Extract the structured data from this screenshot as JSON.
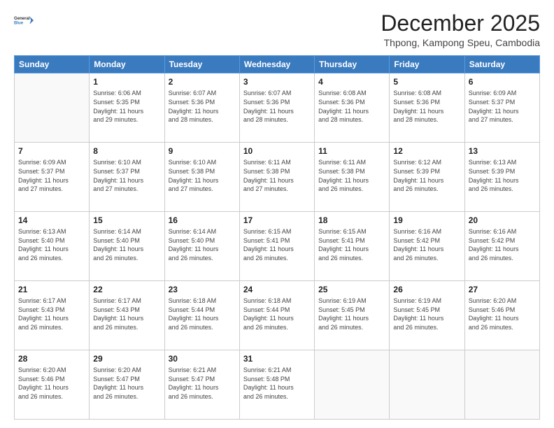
{
  "header": {
    "logo_general": "General",
    "logo_blue": "Blue",
    "month_title": "December 2025",
    "location": "Thpong, Kampong Speu, Cambodia"
  },
  "days_of_week": [
    "Sunday",
    "Monday",
    "Tuesday",
    "Wednesday",
    "Thursday",
    "Friday",
    "Saturday"
  ],
  "weeks": [
    [
      {
        "day": "",
        "info": ""
      },
      {
        "day": "1",
        "info": "Sunrise: 6:06 AM\nSunset: 5:35 PM\nDaylight: 11 hours\nand 29 minutes."
      },
      {
        "day": "2",
        "info": "Sunrise: 6:07 AM\nSunset: 5:36 PM\nDaylight: 11 hours\nand 28 minutes."
      },
      {
        "day": "3",
        "info": "Sunrise: 6:07 AM\nSunset: 5:36 PM\nDaylight: 11 hours\nand 28 minutes."
      },
      {
        "day": "4",
        "info": "Sunrise: 6:08 AM\nSunset: 5:36 PM\nDaylight: 11 hours\nand 28 minutes."
      },
      {
        "day": "5",
        "info": "Sunrise: 6:08 AM\nSunset: 5:36 PM\nDaylight: 11 hours\nand 28 minutes."
      },
      {
        "day": "6",
        "info": "Sunrise: 6:09 AM\nSunset: 5:37 PM\nDaylight: 11 hours\nand 27 minutes."
      }
    ],
    [
      {
        "day": "7",
        "info": "Sunrise: 6:09 AM\nSunset: 5:37 PM\nDaylight: 11 hours\nand 27 minutes."
      },
      {
        "day": "8",
        "info": "Sunrise: 6:10 AM\nSunset: 5:37 PM\nDaylight: 11 hours\nand 27 minutes."
      },
      {
        "day": "9",
        "info": "Sunrise: 6:10 AM\nSunset: 5:38 PM\nDaylight: 11 hours\nand 27 minutes."
      },
      {
        "day": "10",
        "info": "Sunrise: 6:11 AM\nSunset: 5:38 PM\nDaylight: 11 hours\nand 27 minutes."
      },
      {
        "day": "11",
        "info": "Sunrise: 6:11 AM\nSunset: 5:38 PM\nDaylight: 11 hours\nand 26 minutes."
      },
      {
        "day": "12",
        "info": "Sunrise: 6:12 AM\nSunset: 5:39 PM\nDaylight: 11 hours\nand 26 minutes."
      },
      {
        "day": "13",
        "info": "Sunrise: 6:13 AM\nSunset: 5:39 PM\nDaylight: 11 hours\nand 26 minutes."
      }
    ],
    [
      {
        "day": "14",
        "info": "Sunrise: 6:13 AM\nSunset: 5:40 PM\nDaylight: 11 hours\nand 26 minutes."
      },
      {
        "day": "15",
        "info": "Sunrise: 6:14 AM\nSunset: 5:40 PM\nDaylight: 11 hours\nand 26 minutes."
      },
      {
        "day": "16",
        "info": "Sunrise: 6:14 AM\nSunset: 5:40 PM\nDaylight: 11 hours\nand 26 minutes."
      },
      {
        "day": "17",
        "info": "Sunrise: 6:15 AM\nSunset: 5:41 PM\nDaylight: 11 hours\nand 26 minutes."
      },
      {
        "day": "18",
        "info": "Sunrise: 6:15 AM\nSunset: 5:41 PM\nDaylight: 11 hours\nand 26 minutes."
      },
      {
        "day": "19",
        "info": "Sunrise: 6:16 AM\nSunset: 5:42 PM\nDaylight: 11 hours\nand 26 minutes."
      },
      {
        "day": "20",
        "info": "Sunrise: 6:16 AM\nSunset: 5:42 PM\nDaylight: 11 hours\nand 26 minutes."
      }
    ],
    [
      {
        "day": "21",
        "info": "Sunrise: 6:17 AM\nSunset: 5:43 PM\nDaylight: 11 hours\nand 26 minutes."
      },
      {
        "day": "22",
        "info": "Sunrise: 6:17 AM\nSunset: 5:43 PM\nDaylight: 11 hours\nand 26 minutes."
      },
      {
        "day": "23",
        "info": "Sunrise: 6:18 AM\nSunset: 5:44 PM\nDaylight: 11 hours\nand 26 minutes."
      },
      {
        "day": "24",
        "info": "Sunrise: 6:18 AM\nSunset: 5:44 PM\nDaylight: 11 hours\nand 26 minutes."
      },
      {
        "day": "25",
        "info": "Sunrise: 6:19 AM\nSunset: 5:45 PM\nDaylight: 11 hours\nand 26 minutes."
      },
      {
        "day": "26",
        "info": "Sunrise: 6:19 AM\nSunset: 5:45 PM\nDaylight: 11 hours\nand 26 minutes."
      },
      {
        "day": "27",
        "info": "Sunrise: 6:20 AM\nSunset: 5:46 PM\nDaylight: 11 hours\nand 26 minutes."
      }
    ],
    [
      {
        "day": "28",
        "info": "Sunrise: 6:20 AM\nSunset: 5:46 PM\nDaylight: 11 hours\nand 26 minutes."
      },
      {
        "day": "29",
        "info": "Sunrise: 6:20 AM\nSunset: 5:47 PM\nDaylight: 11 hours\nand 26 minutes."
      },
      {
        "day": "30",
        "info": "Sunrise: 6:21 AM\nSunset: 5:47 PM\nDaylight: 11 hours\nand 26 minutes."
      },
      {
        "day": "31",
        "info": "Sunrise: 6:21 AM\nSunset: 5:48 PM\nDaylight: 11 hours\nand 26 minutes."
      },
      {
        "day": "",
        "info": ""
      },
      {
        "day": "",
        "info": ""
      },
      {
        "day": "",
        "info": ""
      }
    ]
  ]
}
